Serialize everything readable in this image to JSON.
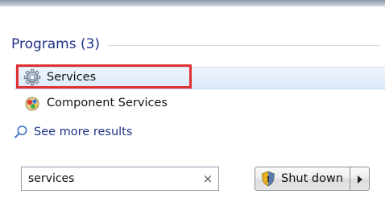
{
  "programs": {
    "header": "Programs (3)",
    "items": [
      {
        "label": "Services",
        "icon": "gear-services-icon",
        "selected": true
      },
      {
        "label": "Component Services",
        "icon": "component-services-icon",
        "selected": false
      }
    ]
  },
  "see_more": {
    "label": "See more results",
    "icon": "search-icon"
  },
  "search": {
    "value": "services",
    "clear_symbol": "×"
  },
  "shutdown": {
    "label": "Shut down",
    "icon": "shield-icon",
    "arrow_icon": "chevron-right-icon"
  },
  "colors": {
    "header_text": "#1e3287",
    "highlight_border": "#e03131",
    "selection_bg": "#dceaf8"
  }
}
